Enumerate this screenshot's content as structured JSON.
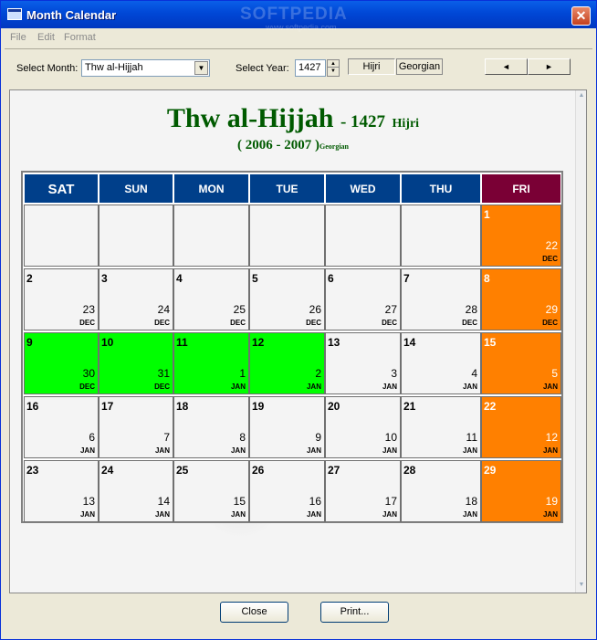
{
  "window": {
    "title": "Month Calendar",
    "watermark": "SOFTPEDIA",
    "watermark_sub": "www.softpedia.com",
    "close_glyph": "✕"
  },
  "menu": [
    "File",
    "Edit",
    "Format"
  ],
  "toolbar": {
    "select_month_label": "Select Month:",
    "month_value": "Thw al-Hijjah",
    "select_year_label": "Select Year:",
    "year_value": "1427",
    "hijri_label": "Hijri",
    "georgian_label": "Georgian",
    "prev_glyph": "◄",
    "next_glyph": "►"
  },
  "heading": {
    "month_name": "Thw al-Hijjah",
    "separator": "- 1427",
    "calendar": "Hijri",
    "greg_range": "( 2006 - 2007 )",
    "greg_label": "Georgian"
  },
  "weekdays": [
    "SAT",
    "SUN",
    "MON",
    "TUE",
    "WED",
    "THU",
    "FRI"
  ],
  "weeks": [
    [
      null,
      null,
      null,
      null,
      null,
      null,
      {
        "h": "1",
        "g": "22",
        "m": "DEC",
        "c": "orange"
      }
    ],
    [
      {
        "h": "2",
        "g": "23",
        "m": "DEC"
      },
      {
        "h": "3",
        "g": "24",
        "m": "DEC"
      },
      {
        "h": "4",
        "g": "25",
        "m": "DEC"
      },
      {
        "h": "5",
        "g": "26",
        "m": "DEC"
      },
      {
        "h": "6",
        "g": "27",
        "m": "DEC"
      },
      {
        "h": "7",
        "g": "28",
        "m": "DEC"
      },
      {
        "h": "8",
        "g": "29",
        "m": "DEC",
        "c": "orange"
      }
    ],
    [
      {
        "h": "9",
        "g": "30",
        "m": "DEC",
        "c": "green"
      },
      {
        "h": "10",
        "g": "31",
        "m": "DEC",
        "c": "green"
      },
      {
        "h": "11",
        "g": "1",
        "m": "JAN",
        "c": "green"
      },
      {
        "h": "12",
        "g": "2",
        "m": "JAN",
        "c": "green"
      },
      {
        "h": "13",
        "g": "3",
        "m": "JAN"
      },
      {
        "h": "14",
        "g": "4",
        "m": "JAN"
      },
      {
        "h": "15",
        "g": "5",
        "m": "JAN",
        "c": "orange"
      }
    ],
    [
      {
        "h": "16",
        "g": "6",
        "m": "JAN"
      },
      {
        "h": "17",
        "g": "7",
        "m": "JAN"
      },
      {
        "h": "18",
        "g": "8",
        "m": "JAN"
      },
      {
        "h": "19",
        "g": "9",
        "m": "JAN"
      },
      {
        "h": "20",
        "g": "10",
        "m": "JAN"
      },
      {
        "h": "21",
        "g": "11",
        "m": "JAN"
      },
      {
        "h": "22",
        "g": "12",
        "m": "JAN",
        "c": "orange"
      }
    ],
    [
      {
        "h": "23",
        "g": "13",
        "m": "JAN"
      },
      {
        "h": "24",
        "g": "14",
        "m": "JAN"
      },
      {
        "h": "25",
        "g": "15",
        "m": "JAN"
      },
      {
        "h": "26",
        "g": "16",
        "m": "JAN"
      },
      {
        "h": "27",
        "g": "17",
        "m": "JAN"
      },
      {
        "h": "28",
        "g": "18",
        "m": "JAN"
      },
      {
        "h": "29",
        "g": "19",
        "m": "JAN",
        "c": "orange"
      }
    ]
  ],
  "colors": {
    "header_blue": "#003f8a",
    "friday_header": "#7a0035",
    "highlight_green": "#00ff00",
    "friday_orange": "#ff8000",
    "heading_green": "#005a00"
  },
  "footer": {
    "close_label": "Close",
    "print_label": "Print..."
  }
}
